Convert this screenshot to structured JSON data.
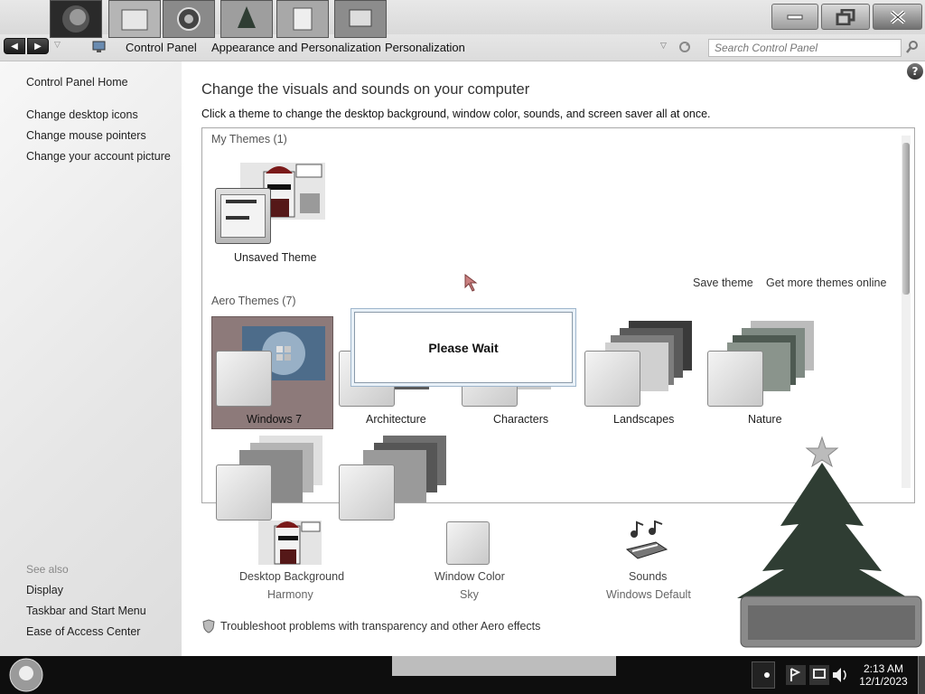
{
  "window": {
    "minimize_label": "minimize",
    "maximize_label": "restore",
    "close_label": "close"
  },
  "nav": {
    "breadcrumbs": [
      "Control Panel",
      "Appearance and Personalization",
      "Personalization"
    ],
    "search_placeholder": "Search Control Panel"
  },
  "sidebar": {
    "home": "Control Panel Home",
    "links": [
      "Change desktop icons",
      "Change mouse pointers",
      "Change your account picture"
    ],
    "see_also_title": "See also",
    "see_also": [
      "Display",
      "Taskbar and Start Menu",
      "Ease of Access Center"
    ]
  },
  "main": {
    "title": "Change the visuals and sounds on your computer",
    "description": "Click a theme to change the desktop background, window color, sounds, and screen saver all at once.",
    "my_themes_header": "My Themes (1)",
    "unsaved_theme": "Unsaved Theme",
    "save_theme": "Save theme",
    "get_more": "Get more themes online",
    "aero_header": "Aero Themes (7)",
    "aero_themes": [
      "Windows 7",
      "Architecture",
      "Characters",
      "Landscapes",
      "Nature"
    ],
    "selected_theme": "Windows 7",
    "dialog_text": "Please Wait",
    "bottom": {
      "background_label": "Desktop Background",
      "background_value": "Harmony",
      "color_label": "Window Color",
      "color_value": "Sky",
      "sounds_label": "Sounds",
      "sounds_value": "Windows Default"
    },
    "troubleshoot": "Troubleshoot problems with transparency and other Aero effects"
  },
  "taskbar": {
    "time": "2:13 AM",
    "date": "12/1/2023"
  }
}
